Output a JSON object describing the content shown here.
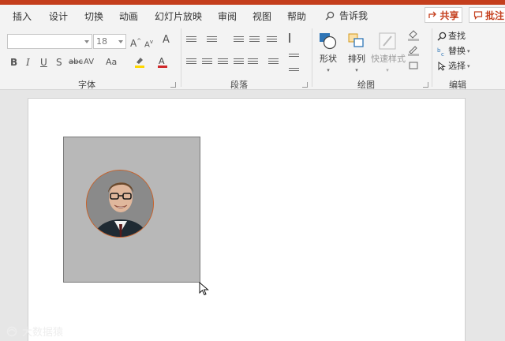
{
  "tabs": [
    "插入",
    "设计",
    "切换",
    "动画",
    "幻灯片放映",
    "审阅",
    "视图",
    "帮助"
  ],
  "tell_me": "告诉我",
  "share_label": "共享",
  "comments_label": "批注",
  "font": {
    "name_value": "",
    "size_value": "18",
    "group_label": "字体"
  },
  "paragraph": {
    "group_label": "段落"
  },
  "drawing": {
    "group_label": "绘图",
    "shapes_label": "形状",
    "arrange_label": "排列",
    "quick_styles_label": "快速样式"
  },
  "editing": {
    "group_label": "编辑",
    "find_label": "查找",
    "replace_label": "替换",
    "select_label": "选择"
  },
  "font_buttons": {
    "bold": "B",
    "italic": "I",
    "underline": "U",
    "shadow": "S",
    "strike": "abc",
    "spacing": "AV",
    "case": "Aa",
    "grow": "A",
    "shrink": "A",
    "clear": "A"
  },
  "watermark": "大数据猿",
  "colors": {
    "accent": "#c43e1c",
    "ribbon_bg": "#f3f3f3",
    "canvas_bg": "#e6e6e6",
    "shape_fill": "#b8b8b8",
    "avatar_border": "#c8622a"
  }
}
